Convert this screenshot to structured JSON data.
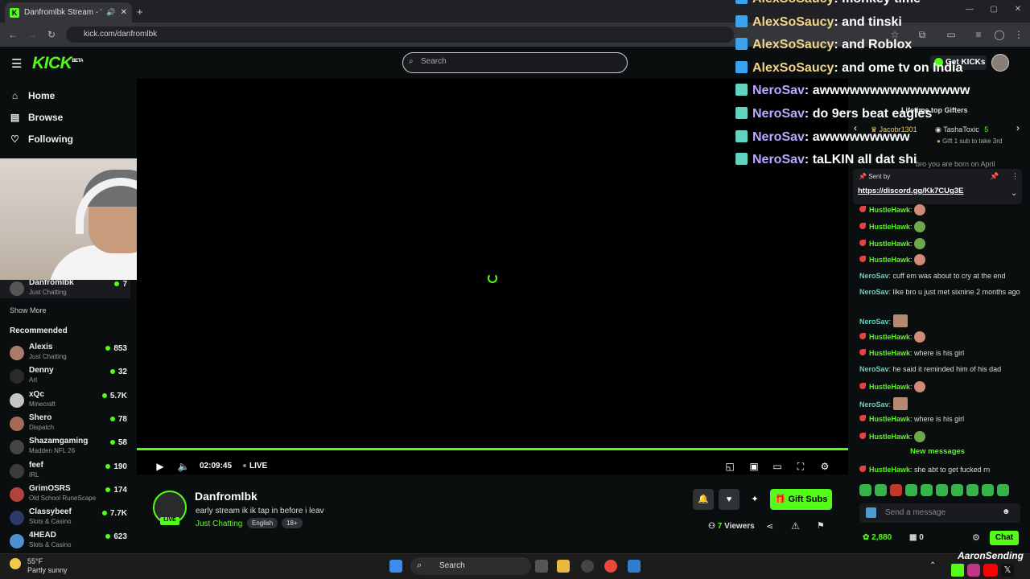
{
  "browser": {
    "tab_title": "Danfromlbk Stream - Watch",
    "url": "kick.com/danfromlbk"
  },
  "header": {
    "logo": "KICK",
    "logo_beta": "BETA",
    "search_placeholder": "Search",
    "get_kicks": "Get KICKs"
  },
  "sidebar": {
    "nav": [
      {
        "label": "Home",
        "icon": "home-icon"
      },
      {
        "label": "Browse",
        "icon": "browse-icon"
      },
      {
        "label": "Following",
        "icon": "heart-icon"
      }
    ],
    "following": [
      {
        "name": "Danfromlbk",
        "category": "Just Chatting",
        "viewers": "7"
      }
    ],
    "show_more": "Show More",
    "recommended_heading": "Recommended",
    "recommended": [
      {
        "name": "Alexis",
        "category": "Just Chatting",
        "viewers": "853",
        "color": "#a97c6a"
      },
      {
        "name": "Denny",
        "category": "Art",
        "viewers": "32",
        "color": "#2b2b2b"
      },
      {
        "name": "xQc",
        "category": "Minecraft",
        "viewers": "5.7K",
        "color": "#c4c4c4"
      },
      {
        "name": "Shero",
        "category": "Dispatch",
        "viewers": "78",
        "color": "#a46b56"
      },
      {
        "name": "Shazamgaming",
        "category": "Madden NFL 26",
        "viewers": "58",
        "color": "#444444"
      },
      {
        "name": "feef",
        "category": "IRL",
        "viewers": "190",
        "color": "#3b3b3b"
      },
      {
        "name": "GrimOSRS",
        "category": "Old School RuneScape",
        "viewers": "174",
        "color": "#b3413e"
      },
      {
        "name": "Classybeef",
        "category": "Slots & Casino",
        "viewers": "7.7K",
        "color": "#2c3a6a"
      },
      {
        "name": "4HEAD",
        "category": "Slots & Casino",
        "viewers": "623",
        "color": "#4e8fd1"
      }
    ]
  },
  "player": {
    "time": "02:09:45",
    "live": "LIVE"
  },
  "stream": {
    "channel": "Danfromlbk",
    "title": "early stream ik ik tap in before i leav",
    "category": "Just Chatting",
    "tags": [
      "English",
      "18+"
    ],
    "live_badge": "LIVE",
    "gift_subs": "Gift Subs",
    "viewers_count": "7",
    "viewers_label": "Viewers"
  },
  "overlay_chat": [
    {
      "name": "AlexSoSaucy",
      "msg": ": monkey time",
      "nero": false
    },
    {
      "name": "AlexSoSaucy",
      "msg": ": and tinski",
      "nero": false
    },
    {
      "name": "AlexSoSaucy",
      "msg": ": and Roblox",
      "nero": false
    },
    {
      "name": "AlexSoSaucy",
      "msg": ": and ome tv on India",
      "nero": false
    },
    {
      "name": "NeroSav",
      "msg": ": awwwwwwwwwwwwwww",
      "nero": true
    },
    {
      "name": "NeroSav",
      "msg": ": do 9ers beat eagles",
      "nero": true
    },
    {
      "name": "NeroSav",
      "msg": ": awwwwwwwww",
      "nero": true
    },
    {
      "name": "NeroSav",
      "msg": ": taLKIN all dat shi",
      "nero": true
    }
  ],
  "chat": {
    "top_gifters_title": "Lifetime top Gifters",
    "gifters": [
      {
        "name": "Jacobr1301"
      },
      {
        "name": "TashaToxic",
        "count": "5"
      }
    ],
    "gift_hint": "Gift 1 sub to take 3rd",
    "pinned_sent_by": "Sent by",
    "pinned_link": "https://discord.gg/Kk7CUg3E",
    "partial_line": "bro you are born on April",
    "messages": [
      {
        "user": "HustleHawk",
        "text": "",
        "emote": "face"
      },
      {
        "user": "HustleHawk",
        "text": "",
        "emote": "frog"
      },
      {
        "user": "HustleHawk",
        "text": "",
        "emote": "frog"
      },
      {
        "user": "HustleHawk",
        "text": "",
        "emote": "face"
      },
      {
        "user": "NeroSav",
        "text": "cuff em was about to cry at the end"
      },
      {
        "user": "NeroSav",
        "text": "like bro u just met sixnine 2 months ago"
      },
      {
        "user": "NeroSav",
        "text": "",
        "emote": "sq"
      },
      {
        "user": "HustleHawk",
        "text": "",
        "emote": "face"
      },
      {
        "user": "HustleHawk",
        "text": "where is his girl"
      },
      {
        "user": "NeroSav",
        "text": "he said it reminded him of his dad"
      },
      {
        "user": "HustleHawk",
        "text": "",
        "emote": "face"
      },
      {
        "user": "NeroSav",
        "text": "",
        "emote": "sq"
      },
      {
        "user": "HustleHawk",
        "text": "where is his girl"
      },
      {
        "user": "HustleHawk",
        "text": "",
        "emote": "frog"
      }
    ],
    "new_messages": "New messages",
    "last_message": {
      "user": "HustleHawk",
      "text": "she abt to get fucked rn"
    },
    "input_placeholder": "Send a message",
    "points": "2,880",
    "subs": "0",
    "chat_button": "Chat"
  },
  "taskbar": {
    "temp": "55°F",
    "weather": "Partly sunny",
    "search": "Search",
    "watermark": "AaronSending"
  }
}
